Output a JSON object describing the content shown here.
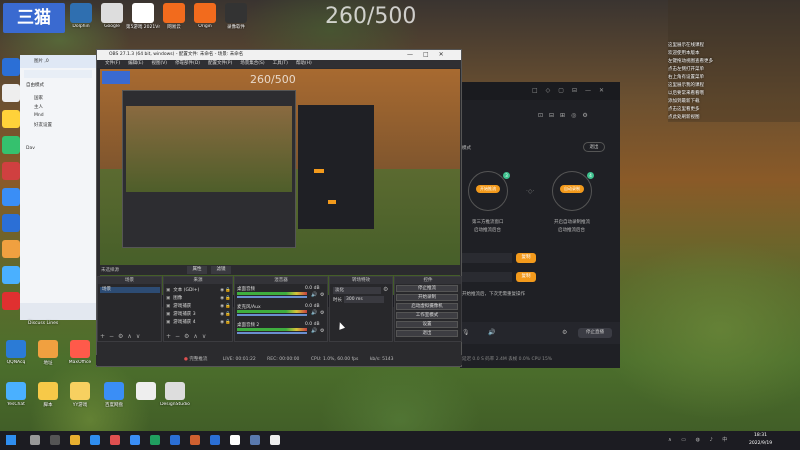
{
  "overlay": {
    "counter": "260/500",
    "logo": "三猫"
  },
  "desktop_icons_top": [
    {
      "label": "Dolphin",
      "color": "#2f6fb0"
    },
    {
      "label": "Google",
      "color": "#dddddd"
    },
    {
      "label": "第5游戏 2021Vm",
      "color": "#ffffff"
    },
    {
      "label": "网易云",
      "color": "#f26b1d"
    },
    {
      "label": "Origin",
      "color": "#f26b1d"
    },
    {
      "label": "录像软件",
      "color": "#333333"
    }
  ],
  "desktop_icons_bottom": [
    {
      "label": "QQNAcq",
      "color": "#2b7bd6"
    },
    {
      "label": "地址",
      "color": "#f0a040"
    },
    {
      "label": "MaxOffice",
      "color": "#ff5a4a"
    },
    {
      "label": "",
      "color": "#8aa0c0"
    },
    {
      "label": "YesChat",
      "color": "#4ab0ff"
    },
    {
      "label": "脚本",
      "color": "#f7c948"
    },
    {
      "label": "YY游戏",
      "color": "#f7d060"
    },
    {
      "label": "百度网盘",
      "color": "#3a8ef6"
    },
    {
      "label": "",
      "color": "#eeeeee"
    },
    {
      "label": "DesignStudio",
      "color": "#dddddd"
    }
  ],
  "chat": {
    "header": "图片 ,0",
    "groups": [
      "自由模式",
      "国家",
      "主人",
      "Mnd",
      "好友设置",
      "Dav"
    ],
    "footer_label": "Discuss Lines"
  },
  "obs": {
    "title": "OBS 27.1.3 (64 bit, windows) - 配置文件: 未命名 - 场景: 未命名",
    "menu": [
      "文件(F)",
      "编辑(E)",
      "视图(V)",
      "停靠部件(D)",
      "配置文件(P)",
      "场景集合(S)",
      "工具(T)",
      "帮助(H)"
    ],
    "preview_counter": "260/500",
    "no_source": "未选择源",
    "props_btn": "属性",
    "filters_btn": "滤镜",
    "docks": {
      "scenes": {
        "title": "场景",
        "items": [
          "场景"
        ]
      },
      "sources": {
        "title": "来源",
        "items": [
          "文本 (GDI+)",
          "图像",
          "游戏捕获",
          "游戏捕获 3",
          "游戏捕获 4"
        ]
      },
      "mixer": {
        "title": "混音器",
        "tracks": [
          {
            "name": "桌面音频",
            "level": "0.0 dB"
          },
          {
            "name": "麦克风/Aux",
            "level": "0.0 dB"
          },
          {
            "name": "桌面音频 2",
            "level": "0.0 dB"
          }
        ]
      },
      "transitions": {
        "title": "转场特效",
        "type": "淡化",
        "duration_label": "时长",
        "duration": "300 ms"
      },
      "controls": {
        "title": "控件",
        "buttons": [
          "停止推流",
          "开始录制",
          "启动虚拟摄像机",
          "工作室模式",
          "设置",
          "退出"
        ]
      }
    },
    "status": "完整推流",
    "status_items": [
      "LIVE: 00:01:22",
      "REC: 00:00:00",
      "CPU: 1.0%, 60.00 fps",
      "kb/s: 5143"
    ]
  },
  "tool": {
    "mode_label": "模式",
    "exit_label": "退出",
    "left_circle": {
      "label": "开始推流",
      "badge": "3"
    },
    "left_caption": "第三方推流窗口",
    "left_subcaption": "启动推流后台",
    "right_circle": {
      "label": "自动录制",
      "badge": "4"
    },
    "right_caption": "开启自动录制推流",
    "right_subcaption": "启动推流后台",
    "field_btn1": "复制",
    "field_btn2": "复制",
    "hint": "开始推流后，下次无需重复操作",
    "bottom_btn": "停止直播",
    "bottom_stats": "延迟 0.0 S  码率 2.4M  丢帧 0.0%  CPU 15%"
  },
  "notes": {
    "lines": [
      "这里展示在线课程",
      "欢迎使用本版本",
      "左键拖动视图查看更多",
      "点击左侧打开菜单",
      "右上角有设置菜单",
      "这里展示我的课程",
      "以后要常来看看哦",
      "添加到最新下载",
      "点击这里看更多",
      "点此处刷新视图"
    ]
  },
  "taskbar": {
    "time": "18:31",
    "date": "2022/9/19"
  }
}
